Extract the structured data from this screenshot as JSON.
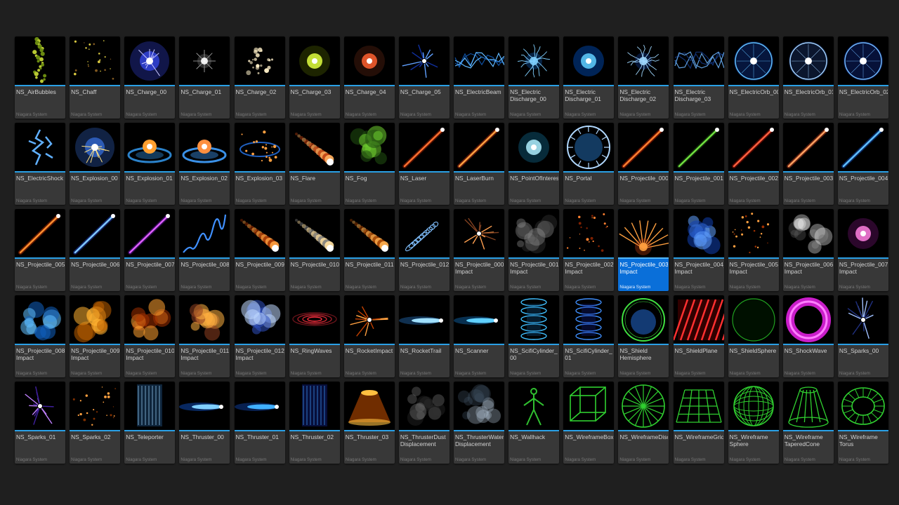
{
  "asset_type_label": "Niagara System",
  "colors": {
    "background": "#1f1f1f",
    "tile": "#383838",
    "selected": "#0a6fd9",
    "thumb_accent": "#2aa0e6"
  },
  "assets": [
    {
      "name": "NS_AirBubbles",
      "fx": "bubbles",
      "c": "#b8c832",
      "c2": "#6a8a10"
    },
    {
      "name": "NS_Chaff",
      "fx": "dots",
      "c": "#d8c840",
      "c2": "#805820"
    },
    {
      "name": "NS_Charge_00",
      "fx": "burst",
      "c": "#c8c8ff",
      "c2": "#3040d0"
    },
    {
      "name": "NS_Charge_01",
      "fx": "star",
      "c": "#ffffff",
      "c2": "#808080"
    },
    {
      "name": "NS_Charge_02",
      "fx": "cluster",
      "c": "#fff0c8",
      "c2": "#806040"
    },
    {
      "name": "NS_Charge_03",
      "fx": "glow",
      "c": "#e0ff40",
      "c2": "#405000"
    },
    {
      "name": "NS_Charge_04",
      "fx": "glow",
      "c": "#ff6030",
      "c2": "#502010"
    },
    {
      "name": "NS_Charge_05",
      "fx": "streaks",
      "c": "#60a0ff",
      "c2": "#1030a0"
    },
    {
      "name": "NS_ElectricBeam",
      "fx": "beam",
      "c": "#60b8ff",
      "c2": "#1050a0"
    },
    {
      "name": "NS_Electric\nDischarge_00",
      "fx": "tendrils",
      "c": "#80d0ff",
      "c2": "#1060c0"
    },
    {
      "name": "NS_Electric\nDischarge_01",
      "fx": "glow",
      "c": "#60d0ff",
      "c2": "#0050c0"
    },
    {
      "name": "NS_Electric\nDischarge_02",
      "fx": "tendrils",
      "c": "#a0d8ff",
      "c2": "#1040a0"
    },
    {
      "name": "NS_Electric\nDischarge_03",
      "fx": "beam",
      "c": "#60a0e0",
      "c2": "#103070"
    },
    {
      "name": "NS_ElectricOrb_00",
      "fx": "orb",
      "c": "#60c0ff",
      "c2": "#1040b0"
    },
    {
      "name": "NS_ElectricOrb_01",
      "fx": "orb",
      "c": "#a0d0ff",
      "c2": "#204080"
    },
    {
      "name": "NS_ElectricOrb_02",
      "fx": "orb",
      "c": "#70b8ff",
      "c2": "#1030a0"
    },
    {
      "name": "NS_ElectricShock",
      "fx": "shock",
      "c": "#60b0ff",
      "c2": "#104090"
    },
    {
      "name": "NS_Explosion_00",
      "fx": "burst",
      "c": "#ffe080",
      "c2": "#3060c0"
    },
    {
      "name": "NS_Explosion_01",
      "fx": "ring-fire",
      "c": "#ffa030",
      "c2": "#3090e0"
    },
    {
      "name": "NS_Explosion_02",
      "fx": "ring-fire",
      "c": "#ff9040",
      "c2": "#40a0ff"
    },
    {
      "name": "NS_Explosion_03",
      "fx": "ring-sparks",
      "c": "#ffa040",
      "c2": "#2060c0"
    },
    {
      "name": "NS_Flare",
      "fx": "trail",
      "c": "#ffb060",
      "c2": "#c04010"
    },
    {
      "name": "NS_Fog",
      "fx": "fog",
      "c": "#70d030",
      "c2": "#205010"
    },
    {
      "name": "NS_Laser",
      "fx": "laser",
      "c": "#ff7030",
      "c2": "#a02000"
    },
    {
      "name": "NS_LaserBurn",
      "fx": "laser",
      "c": "#ffa040",
      "c2": "#c03010"
    },
    {
      "name": "NS_PointOfInterest",
      "fx": "glow",
      "c": "#b0f0ff",
      "c2": "#106080"
    },
    {
      "name": "NS_Portal",
      "fx": "portal",
      "c": "#b0d8ff",
      "c2": "#2060a0"
    },
    {
      "name": "NS_Projectile_000",
      "fx": "laser",
      "c": "#ff8030",
      "c2": "#c02000"
    },
    {
      "name": "NS_Projectile_001",
      "fx": "laser",
      "c": "#70e040",
      "c2": "#205010"
    },
    {
      "name": "NS_Projectile_002",
      "fx": "laser",
      "c": "#ff6040",
      "c2": "#a01000"
    },
    {
      "name": "NS_Projectile_003",
      "fx": "laser",
      "c": "#ffa060",
      "c2": "#c04020"
    },
    {
      "name": "NS_Projectile_004",
      "fx": "laser",
      "c": "#60c0ff",
      "c2": "#1050c0"
    },
    {
      "name": "NS_Projectile_005",
      "fx": "laser",
      "c": "#ff9030",
      "c2": "#c03000"
    },
    {
      "name": "NS_Projectile_006",
      "fx": "laser",
      "c": "#80c8ff",
      "c2": "#2040c0"
    },
    {
      "name": "NS_Projectile_007",
      "fx": "laser",
      "c": "#e060ff",
      "c2": "#6010a0"
    },
    {
      "name": "NS_Projectile_008",
      "fx": "wiggle",
      "c": "#4090ff",
      "c2": "#102080"
    },
    {
      "name": "NS_Projectile_009",
      "fx": "trail",
      "c": "#ffa040",
      "c2": "#a03000"
    },
    {
      "name": "NS_Projectile_010",
      "fx": "trail",
      "c": "#ffe0a0",
      "c2": "#808080"
    },
    {
      "name": "NS_Projectile_011",
      "fx": "trail",
      "c": "#ffb050",
      "c2": "#a04000"
    },
    {
      "name": "NS_Projectile_012",
      "fx": "spiral",
      "c": "#80c0ff",
      "c2": "#2050a0"
    },
    {
      "name": "NS_Projectile_000_\nImpact",
      "fx": "streaks",
      "c": "#ffa050",
      "c2": "#804020"
    },
    {
      "name": "NS_Projectile_001_\nImpact",
      "fx": "smoke",
      "c": "#a0a0a0",
      "c2": "#404040"
    },
    {
      "name": "NS_Projectile_002_\nImpact",
      "fx": "dots",
      "c": "#ff8030",
      "c2": "#802000"
    },
    {
      "name": "NS_Projectile_003_\nImpact",
      "fx": "fan",
      "c": "#ffa040",
      "c2": "#c04010",
      "selected": true
    },
    {
      "name": "NS_Projectile_004_\nImpact",
      "fx": "fog",
      "c": "#60a0ff",
      "c2": "#1040b0"
    },
    {
      "name": "NS_Projectile_005_\nImpact",
      "fx": "dots",
      "c": "#ffa040",
      "c2": "#a03000"
    },
    {
      "name": "NS_Projectile_006_\nImpact",
      "fx": "smoke",
      "c": "#ffffff",
      "c2": "#606060"
    },
    {
      "name": "NS_Projectile_007_\nImpact",
      "fx": "glow",
      "c": "#ff80e0",
      "c2": "#601060"
    },
    {
      "name": "NS_Projectile_008_\nImpact",
      "fx": "fog",
      "c": "#60c0ff",
      "c2": "#1060c0"
    },
    {
      "name": "NS_Projectile_009_\nImpact",
      "fx": "fog",
      "c": "#ffb030",
      "c2": "#c06000"
    },
    {
      "name": "NS_Projectile_010_\nImpact",
      "fx": "fog",
      "c": "#ffa030",
      "c2": "#a03000"
    },
    {
      "name": "NS_Projectile_011_\nImpact",
      "fx": "fog",
      "c": "#ffb040",
      "c2": "#904020"
    },
    {
      "name": "NS_Projectile_012_\nImpact",
      "fx": "fog",
      "c": "#c0d8ff",
      "c2": "#3050c0"
    },
    {
      "name": "NS_RingWaves",
      "fx": "rings",
      "c": "#ff3040",
      "c2": "#600010"
    },
    {
      "name": "NS_RocketImpact",
      "fx": "streaks",
      "c": "#ffa040",
      "c2": "#c04000"
    },
    {
      "name": "NS_RocketTrail",
      "fx": "jet",
      "c": "#a0e0ff",
      "c2": "#2060a0"
    },
    {
      "name": "NS_Scanner",
      "fx": "jet",
      "c": "#60d0ff",
      "c2": "#1060a0"
    },
    {
      "name": "NS_ScifiCylinder_\n00",
      "fx": "cylinder",
      "c": "#40c0ff",
      "c2": "#105080"
    },
    {
      "name": "NS_ScifiCylinder_\n01",
      "fx": "cylinder",
      "c": "#4090ff",
      "c2": "#102080"
    },
    {
      "name": "NS_Shield\nHemisphere",
      "fx": "shield",
      "c": "#40e040",
      "c2": "#2060c0"
    },
    {
      "name": "NS_ShieldPlane",
      "fx": "stripes",
      "c": "#ff3030",
      "c2": "#600000"
    },
    {
      "name": "NS_ShieldSphere",
      "fx": "sphere",
      "c": "#20a020",
      "c2": "#001000"
    },
    {
      "name": "NS_ShockWave",
      "fx": "donut",
      "c": "#e020e0",
      "c2": "#400040"
    },
    {
      "name": "NS_Sparks_00",
      "fx": "streaks",
      "c": "#a0c0ff",
      "c2": "#203080"
    },
    {
      "name": "NS_Sparks_01",
      "fx": "streaks",
      "c": "#c080ff",
      "c2": "#4020a0"
    },
    {
      "name": "NS_Sparks_02",
      "fx": "dots",
      "c": "#ffa040",
      "c2": "#803000"
    },
    {
      "name": "NS_Teleporter",
      "fx": "column",
      "c": "#a0d8ff",
      "c2": "#205080"
    },
    {
      "name": "NS_Thruster_00",
      "fx": "jet",
      "c": "#80d0ff",
      "c2": "#1050c0"
    },
    {
      "name": "NS_Thruster_01",
      "fx": "jet",
      "c": "#40b0ff",
      "c2": "#1040a0"
    },
    {
      "name": "NS_Thruster_02",
      "fx": "column",
      "c": "#40a0ff",
      "c2": "#102080"
    },
    {
      "name": "NS_Thruster_03",
      "fx": "cone",
      "c": "#ffc040",
      "c2": "#a04000"
    },
    {
      "name": "NS_ThrusterDust\nDisplacement",
      "fx": "smoke",
      "c": "#808080",
      "c2": "#303030"
    },
    {
      "name": "NS_ThrusterWater\nDisplacement",
      "fx": "smoke",
      "c": "#b0c0d0",
      "c2": "#405060"
    },
    {
      "name": "NS_Wallhack",
      "fx": "figure",
      "c": "#30c030",
      "c2": "#104010"
    },
    {
      "name": "NS_WireframeBox",
      "fx": "cube",
      "c": "#30d030",
      "c2": "#104010"
    },
    {
      "name": "NS_WireframeDisc",
      "fx": "disc",
      "c": "#30d030",
      "c2": "#104010"
    },
    {
      "name": "NS_WireframeGrid",
      "fx": "grid",
      "c": "#30d030",
      "c2": "#104010"
    },
    {
      "name": "NS_Wireframe\nSphere",
      "fx": "wsphere",
      "c": "#30d030",
      "c2": "#104010"
    },
    {
      "name": "NS_Wireframe\nTaperedCone",
      "fx": "wcone",
      "c": "#30d030",
      "c2": "#104010"
    },
    {
      "name": "NS_Wireframe\nTorus",
      "fx": "torus",
      "c": "#30d030",
      "c2": "#104010"
    }
  ]
}
